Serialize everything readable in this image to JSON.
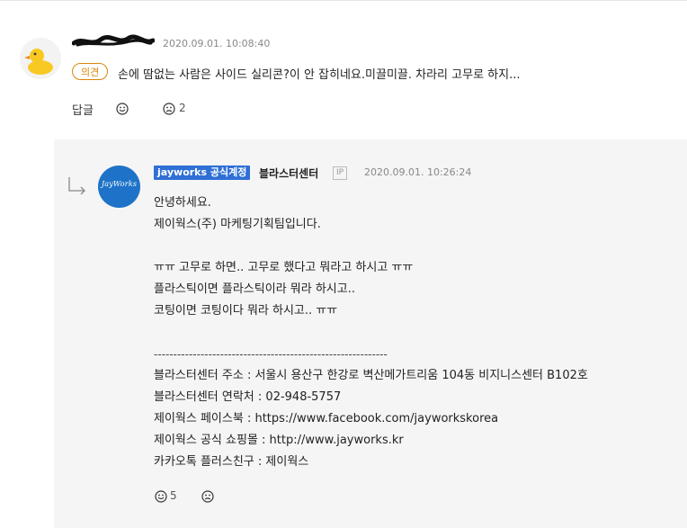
{
  "comment": {
    "timestamp": "2020.09.01. 10:08:40",
    "badge": "의견",
    "text": "손에 땀없는 사람은 사이드 실리콘?이 안 잡히네요.미끌미끌. 차라리 고무로 하지...",
    "reply_label": "답글",
    "like_count": "",
    "dislike_count": "2"
  },
  "reply": {
    "official_badge": "jayworks 공식계정",
    "author": "블라스터센터",
    "ip_label": "IP",
    "timestamp": "2020.09.01. 10:26:24",
    "avatar_text": "JayWorks",
    "lines": [
      "안녕하세요.",
      "제이웍스(주) 마케팅기획팀입니다.",
      "",
      "ㅠㅠ 고무로 하면.. 고무로 했다고 뭐라고 하시고 ㅠㅠ",
      "플라스틱이면 플라스틱이라 뭐라 하시고..",
      "코팅이면 코팅이다 뭐라 하시고.. ㅠㅠ",
      "",
      "------------------------------------------------------------",
      "블라스터센터 주소 : 서울시 용산구 한강로 벽산메가트리움 104동 비지니스센터 B102호",
      "블라스터센터 연락처 : 02-948-5757",
      "제이웍스 페이스북 : https://www.facebook.com/jayworkskorea",
      "제이웍스 공식 쇼핑몰 : http://www.jayworks.kr",
      "카카오톡 플러스친구 : 제이웍스"
    ],
    "like_count": "5",
    "dislike_count": ""
  },
  "colors": {
    "badge_orange": "#d9860a",
    "official_blue": "#2f6fd6",
    "panel_bg": "#f5f5f5"
  },
  "icons": {
    "like": "smile-face-icon",
    "dislike": "frown-face-icon",
    "reply_arrow": "reply-arrow-icon"
  }
}
